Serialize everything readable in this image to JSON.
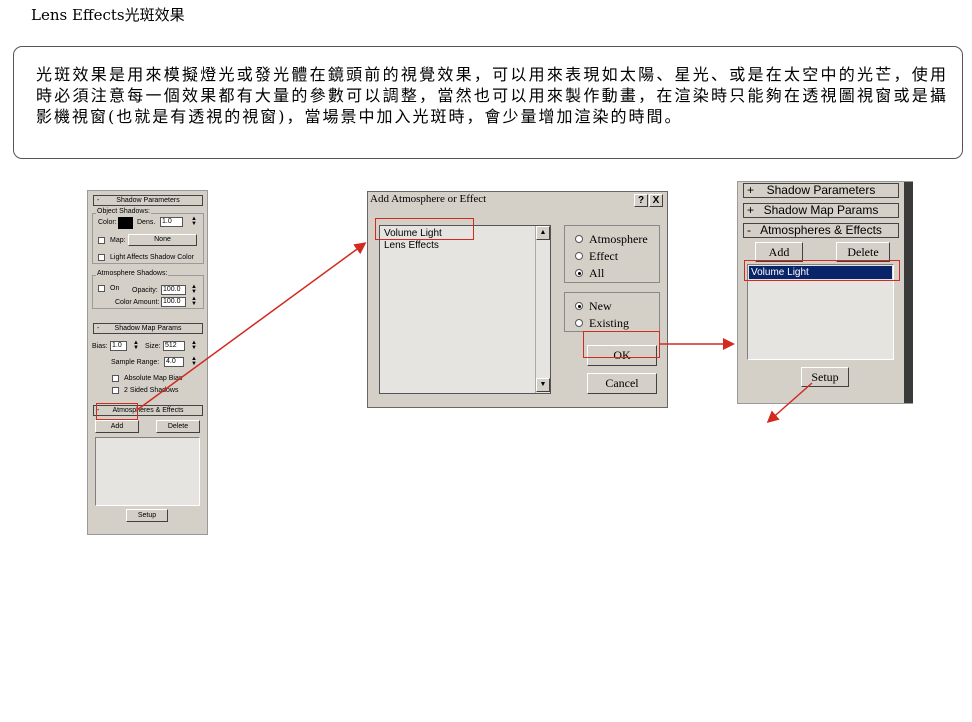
{
  "page": {
    "title": "Lens Effects光斑效果",
    "intro": "光斑效果是用來模擬燈光或發光體在鏡頭前的視覺效果，可以用來表現如太陽、星光、或是在太空中的光芒，使用時必須注意每一個效果都有大量的參數可以調整，當然也可以用來製作動畫，在渲染時只能夠在透視圖視窗或是攝影機視窗(也就是有透視的視窗)，當場景中加入光斑時，會少量增加渲染的時間。"
  },
  "left_panel": {
    "shadow_params": {
      "title": "Shadow Parameters",
      "collapse": "-",
      "object_shadows_label": "Object Shadows:",
      "color_label": "Color:",
      "color_value": "#000000",
      "dens_label": "Dens.",
      "dens_value": "1.0",
      "map_label": "Map:",
      "map_button": "None",
      "light_affects_label": "Light Affects Shadow Color",
      "atmo_shadows_label": "Atmosphere Shadows:",
      "on_label": "On",
      "opacity_label": "Opacity:",
      "opacity_value": "100.0",
      "color_amount_label": "Color Amount:",
      "color_amount_value": "100.0"
    },
    "shadow_map": {
      "title": "Shadow Map Params",
      "collapse": "-",
      "bias_label": "Bias:",
      "bias_value": "1.0",
      "size_label": "Size:",
      "size_value": "512",
      "sample_range_label": "Sample Range:",
      "sample_range_value": "4.0",
      "abs_bias_label": "Absolute Map Bias",
      "two_sided_label": "2 Sided Shadows"
    },
    "atmo_effects": {
      "title": "Atmospheres & Effects",
      "collapse": "-",
      "add": "Add",
      "delete": "Delete",
      "setup": "Setup"
    }
  },
  "dialog": {
    "title": "Add Atmosphere or Effect",
    "help_button": "?",
    "close_button": "X",
    "items": [
      "Volume Light",
      "Lens Effects"
    ],
    "filter_options": [
      "Atmosphere",
      "Effect",
      "All"
    ],
    "filter_selected": "All",
    "mode_options": [
      "New",
      "Existing"
    ],
    "mode_selected": "New",
    "ok": "OK",
    "cancel": "Cancel"
  },
  "right_panel": {
    "rollouts": [
      {
        "sign": "+",
        "title": "Shadow Parameters"
      },
      {
        "sign": "+",
        "title": "Shadow Map Params"
      },
      {
        "sign": "-",
        "title": "Atmospheres & Effects"
      }
    ],
    "add": "Add",
    "delete": "Delete",
    "list_item": "Volume Light",
    "setup": "Setup"
  },
  "colors": {
    "panel": "#d4d0c8",
    "highlight": "#d22a20",
    "title_bar": "#0a246a",
    "selection": "#0a246a"
  }
}
